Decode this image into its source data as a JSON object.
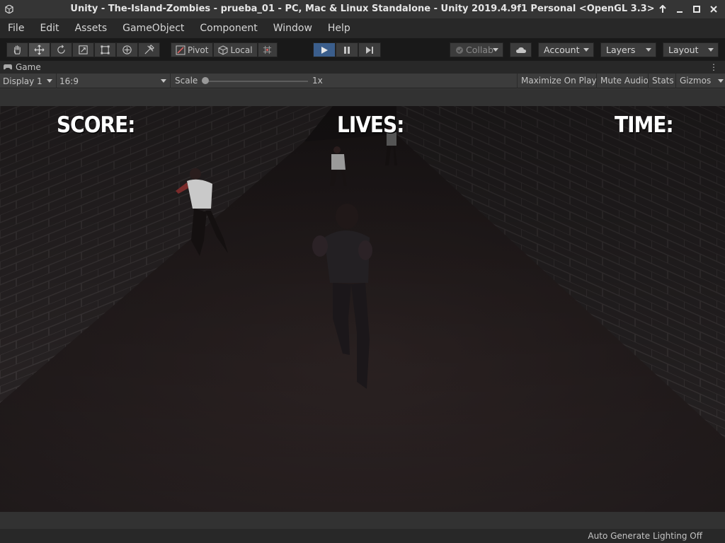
{
  "window": {
    "title": "Unity - The-Island-Zombies - prueba_01 - PC, Mac & Linux Standalone - Unity 2019.4.9f1 Personal <OpenGL 3.3>",
    "buttons": [
      "up-arrow",
      "minimize",
      "maximize",
      "close"
    ]
  },
  "menu": {
    "items": [
      "File",
      "Edit",
      "Assets",
      "GameObject",
      "Component",
      "Window",
      "Help"
    ]
  },
  "toolbar": {
    "transform_tools": [
      "hand-tool",
      "move-tool",
      "rotate-tool",
      "scale-tool",
      "rect-tool",
      "transform-tool",
      "custom-tool"
    ],
    "pivot_label": "Pivot",
    "local_label": "Local",
    "collab_label": "Collab",
    "account_label": "Account",
    "layers_label": "Layers",
    "layout_label": "Layout",
    "play_state": "playing"
  },
  "game_tab": {
    "label": "Game"
  },
  "game_controls": {
    "display": "Display 1",
    "aspect": "16:9",
    "scale_label": "Scale",
    "scale_value": "1x",
    "maximize_on_play": "Maximize On Play",
    "mute_audio": "Mute Audio",
    "stats": "Stats",
    "gizmos": "Gizmos"
  },
  "hud": {
    "score": "SCORE:",
    "lives": "LIVES:",
    "time": "TIME:"
  },
  "status": {
    "text": "Auto Generate Lighting Off"
  },
  "colors": {
    "play_accent": "#3b5e8c",
    "editor_bg": "#383838",
    "toolbar_bg": "#191919"
  }
}
